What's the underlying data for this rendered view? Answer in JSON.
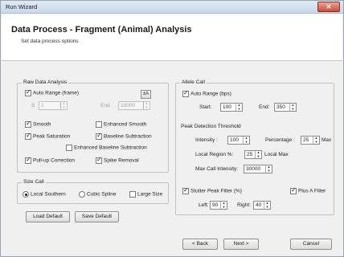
{
  "window": {
    "title": "Run Wizard",
    "center_text": ""
  },
  "header": {
    "title": "Data Process - Fragment (Animal) Analysis",
    "subtitle": "Set data process options"
  },
  "raw": {
    "title": "Raw Data Analysis",
    "auto_range": {
      "label": "Auto Range (frame)",
      "checked": true
    },
    "range_icon_text": "±A",
    "start_value": "1",
    "end_value": "10000",
    "smooth": {
      "label": "Smooth",
      "checked": true
    },
    "enhanced_smooth": {
      "label": "Enhanced Smooth",
      "checked": false
    },
    "peak_saturation": {
      "label": "Peak Saturation",
      "checked": true
    },
    "baseline_subtraction": {
      "label": "Baseline Subtraction",
      "checked": true
    },
    "enhanced_baseline": {
      "label": "Enhanced Baseline Subtraction",
      "checked": false
    },
    "pullup": {
      "label": "Pull-up Correction",
      "checked": true
    },
    "spike": {
      "label": "Spike Removal",
      "checked": true
    }
  },
  "size_call": {
    "title": "Size Call",
    "local_southern": {
      "label": "Local Southern",
      "selected": true
    },
    "cubic_spline": {
      "label": "Cubic Spline",
      "selected": false
    },
    "large_size": {
      "label": "Large Size",
      "checked": false
    }
  },
  "buttons": {
    "load_default": "Load Default",
    "save_default": "Save Default",
    "back": "< Back",
    "next": "Next >",
    "cancel": "Cancel"
  },
  "allele": {
    "title": "Allele Call",
    "auto_range": {
      "label": "Auto Range (bps)",
      "checked": true
    },
    "start_label": "Start:",
    "start_value": "100",
    "end_label": "End:",
    "end_value": "350",
    "peak_threshold_title": "Peak Detection Threshold",
    "intensity_label": "Intensity :",
    "intensity_value": "100",
    "percentage_label": "Percentage :",
    "percentage_value": "25",
    "max_label": "Max",
    "local_region_label": "Local Region %:",
    "local_region_value": "25",
    "local_max_label": "Local Max",
    "max_call_label": "Max Call Intensity:",
    "max_call_value": "30000",
    "stutter": {
      "label": "Stutter Peak Filter (%)",
      "checked": true
    },
    "plus_a": {
      "label": "Plus A Filter",
      "checked": true
    },
    "left_label": "Left:",
    "left_value": "90",
    "right_label": "Right:",
    "right_value": "40"
  }
}
